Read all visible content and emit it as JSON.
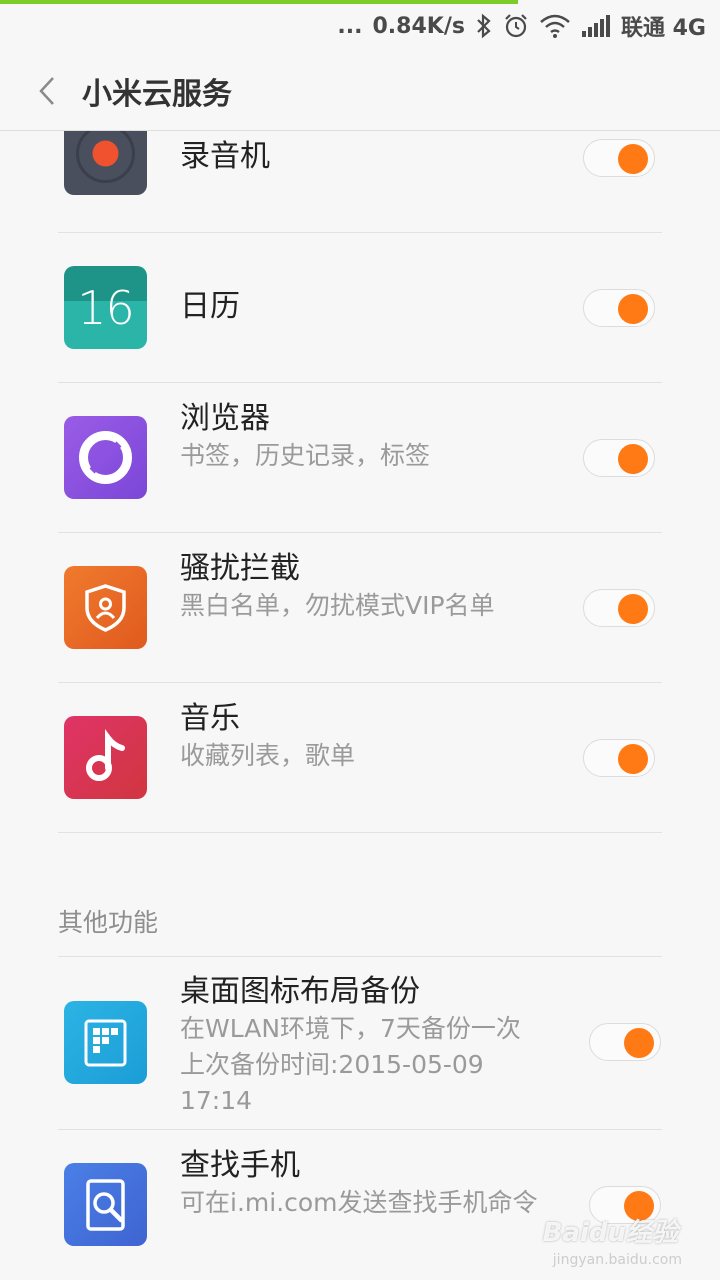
{
  "status_bar": {
    "dots": "...",
    "speed": "0.84K/s",
    "carrier": "联通 4G",
    "icons": [
      "bluetooth-icon",
      "alarm-icon",
      "wifi-icon",
      "signal-icon"
    ]
  },
  "header": {
    "title": "小米云服务",
    "back_icon": "chevron-left-icon"
  },
  "items": [
    {
      "title": "录音机",
      "subtitle": "",
      "enabled": true,
      "icon": "recorder-icon"
    },
    {
      "title": "日历",
      "subtitle": "",
      "enabled": true,
      "icon": "calendar-icon",
      "icon_text": "16"
    },
    {
      "title": "浏览器",
      "subtitle": "书签，历史记录，标签",
      "enabled": true,
      "icon": "browser-icon"
    },
    {
      "title": "骚扰拦截",
      "subtitle": "黑白名单，勿扰模式VIP名单",
      "enabled": true,
      "icon": "shield-user-icon"
    },
    {
      "title": "音乐",
      "subtitle": "收藏列表，歌单",
      "enabled": true,
      "icon": "music-note-icon"
    }
  ],
  "other_section": {
    "header": "其他功能",
    "items": [
      {
        "title": "桌面图标布局备份",
        "subtitle_lines": [
          "在WLAN环境下，7天备份一次",
          "上次备份时间:2015-05-09",
          "17:14"
        ],
        "enabled": true,
        "icon": "desktop-layout-icon"
      },
      {
        "title": "查找手机",
        "subtitle": "可在i.mi.com发送查找手机命令",
        "enabled": true,
        "icon": "find-phone-icon"
      }
    ]
  },
  "watermark": {
    "text": "Baidu经验",
    "sub": "jingyan.baidu.com"
  },
  "colors": {
    "accent": "#ff7a14",
    "progress": "#7ccd2a"
  }
}
